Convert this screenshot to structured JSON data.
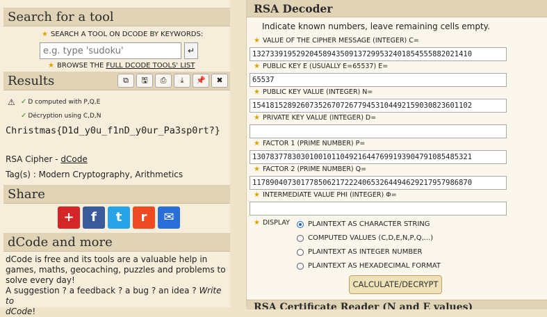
{
  "left": {
    "search": {
      "title": "Search for a tool",
      "label": "SEARCH A TOOL ON DCODE BY KEYWORDS:",
      "placeholder": "e.g. type 'sudoku'",
      "enter_icon": "↵",
      "browse_prefix": "BROWSE THE",
      "browse_link": "FULL DCODE TOOLS' LIST"
    },
    "results": {
      "title": "Results",
      "toolbar": [
        "copy-icon",
        "save-icon",
        "print-icon",
        "download-icon",
        "pin-icon",
        "close-icon"
      ],
      "toolbar_glyphs": [
        "⧉",
        "🖫",
        "⎙",
        "⤓",
        "📌",
        "✖"
      ],
      "lines": [
        "D computed with P,Q,E",
        "Décryption using C,D,N"
      ],
      "output": "Christmas{D1d_y0u_f1nD_y0ur_Pa3sp0rt?}",
      "cipher_prefix": "RSA Cipher - ",
      "cipher_link": "dCode",
      "tags": "Tag(s) : Modern Cryptography, Arithmetics"
    },
    "share": {
      "title": "Share",
      "buttons": [
        {
          "name": "share-more-button",
          "glyph": "+",
          "color": "#d42626"
        },
        {
          "name": "share-facebook-button",
          "glyph": "f",
          "color": "#3b5a9a"
        },
        {
          "name": "share-twitter-button",
          "glyph": "t",
          "color": "#29a3e8"
        },
        {
          "name": "share-reddit-button",
          "glyph": "r",
          "color": "#ef4b23"
        },
        {
          "name": "share-email-button",
          "glyph": "✉",
          "color": "#2a6fd8"
        }
      ]
    },
    "dcode": {
      "title": "dCode and more",
      "text": "dCode is free and its tools are a valuable help in games, maths, geocaching, puzzles and problems to solve every day!",
      "suggest": "A suggestion ? a feedback ? a bug ? an idea ? ",
      "write_to": "Write to",
      "write_to_tail": "dCode",
      "tail": "!"
    }
  },
  "right": {
    "title": "RSA Decoder",
    "intro": "Indicate known numbers, leave remaining cells empty.",
    "fields": [
      {
        "label": "VALUE OF THE CIPHER MESSAGE (INTEGER) C=",
        "value": "13273391952920458943509137299532401854555882021410"
      },
      {
        "label": "PUBLIC KEY E (USUALLY E=65537) E=",
        "value": "65537"
      },
      {
        "label": "PUBLIC KEY VALUE (INTEGER) N=",
        "value": "15418152892607352670726779453104492159030823601102"
      },
      {
        "label": "PRIVATE KEY VALUE (INTEGER) D=",
        "value": ""
      },
      {
        "label": "FACTOR 1 (PRIME NUMBER) P=",
        "value": "13078377830301001011049216447699193904791085485321"
      },
      {
        "label": "FACTOR 2 (PRIME NUMBER) Q=",
        "value": "11789040730177850621722240653264494629217957986870"
      },
      {
        "label": "INTERMEDIATE VALUE PHI (INTEGER) Φ=",
        "value": ""
      }
    ],
    "display_label": "DISPLAY",
    "display_options": [
      {
        "label": "PLAINTEXT AS CHARACTER STRING",
        "selected": true
      },
      {
        "label": "COMPUTED VALUES (C,D,E,N,P,Q,...)",
        "selected": false
      },
      {
        "label": "PLAINTEXT AS INTEGER NUMBER",
        "selected": false
      },
      {
        "label": "PLAINTEXT AS HEXADECIMAL FORMAT",
        "selected": false
      }
    ],
    "calculate_label": "CALCULATE/DECRYPT",
    "next_section": "RSA Certificate Reader (N and E values)"
  }
}
